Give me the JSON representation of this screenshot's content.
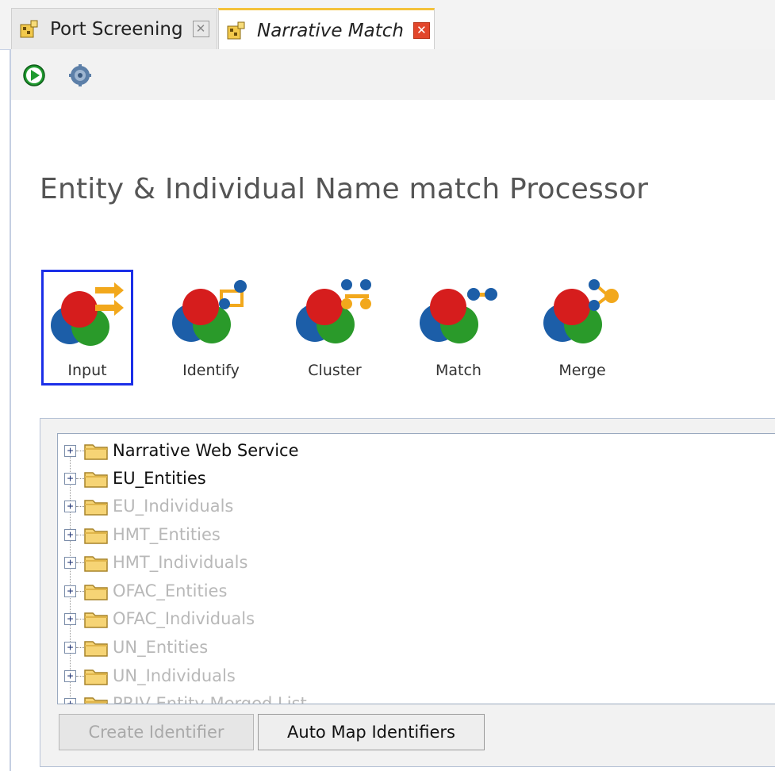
{
  "tabs": [
    {
      "label": "Port Screening",
      "active": false,
      "icon": "project-icon",
      "close": "close-icon"
    },
    {
      "label": "Narrative Match",
      "active": true,
      "icon": "project-icon",
      "close": "close-icon"
    }
  ],
  "toolbar": {
    "run_icon": "run-icon",
    "settings_icon": "settings-gear-icon"
  },
  "page_title": "Entity & Individual Name match Processor",
  "processes": [
    {
      "label": "Input",
      "selected": true
    },
    {
      "label": "Identify",
      "selected": false
    },
    {
      "label": "Cluster",
      "selected": false
    },
    {
      "label": "Match",
      "selected": false
    },
    {
      "label": "Merge",
      "selected": false
    }
  ],
  "tree": {
    "items": [
      {
        "label": "Narrative Web Service",
        "enabled": true
      },
      {
        "label": "EU_Entities",
        "enabled": true
      },
      {
        "label": "EU_Individuals",
        "enabled": false
      },
      {
        "label": "HMT_Entities",
        "enabled": false
      },
      {
        "label": "HMT_Individuals",
        "enabled": false
      },
      {
        "label": "OFAC_Entities",
        "enabled": false
      },
      {
        "label": "OFAC_Individuals",
        "enabled": false
      },
      {
        "label": "UN_Entities",
        "enabled": false
      },
      {
        "label": "UN_Individuals",
        "enabled": false
      },
      {
        "label": "PRIV Entity Merged List",
        "enabled": false
      }
    ]
  },
  "buttons": {
    "create_identifier": "Create Identifier",
    "auto_map_identifiers": "Auto Map Identifiers"
  },
  "colors": {
    "selection_border": "#1b2fe8",
    "active_tab_accent": "#f4c23a",
    "close_active": "#e2462b",
    "disabled_text": "#b8b8b8"
  }
}
